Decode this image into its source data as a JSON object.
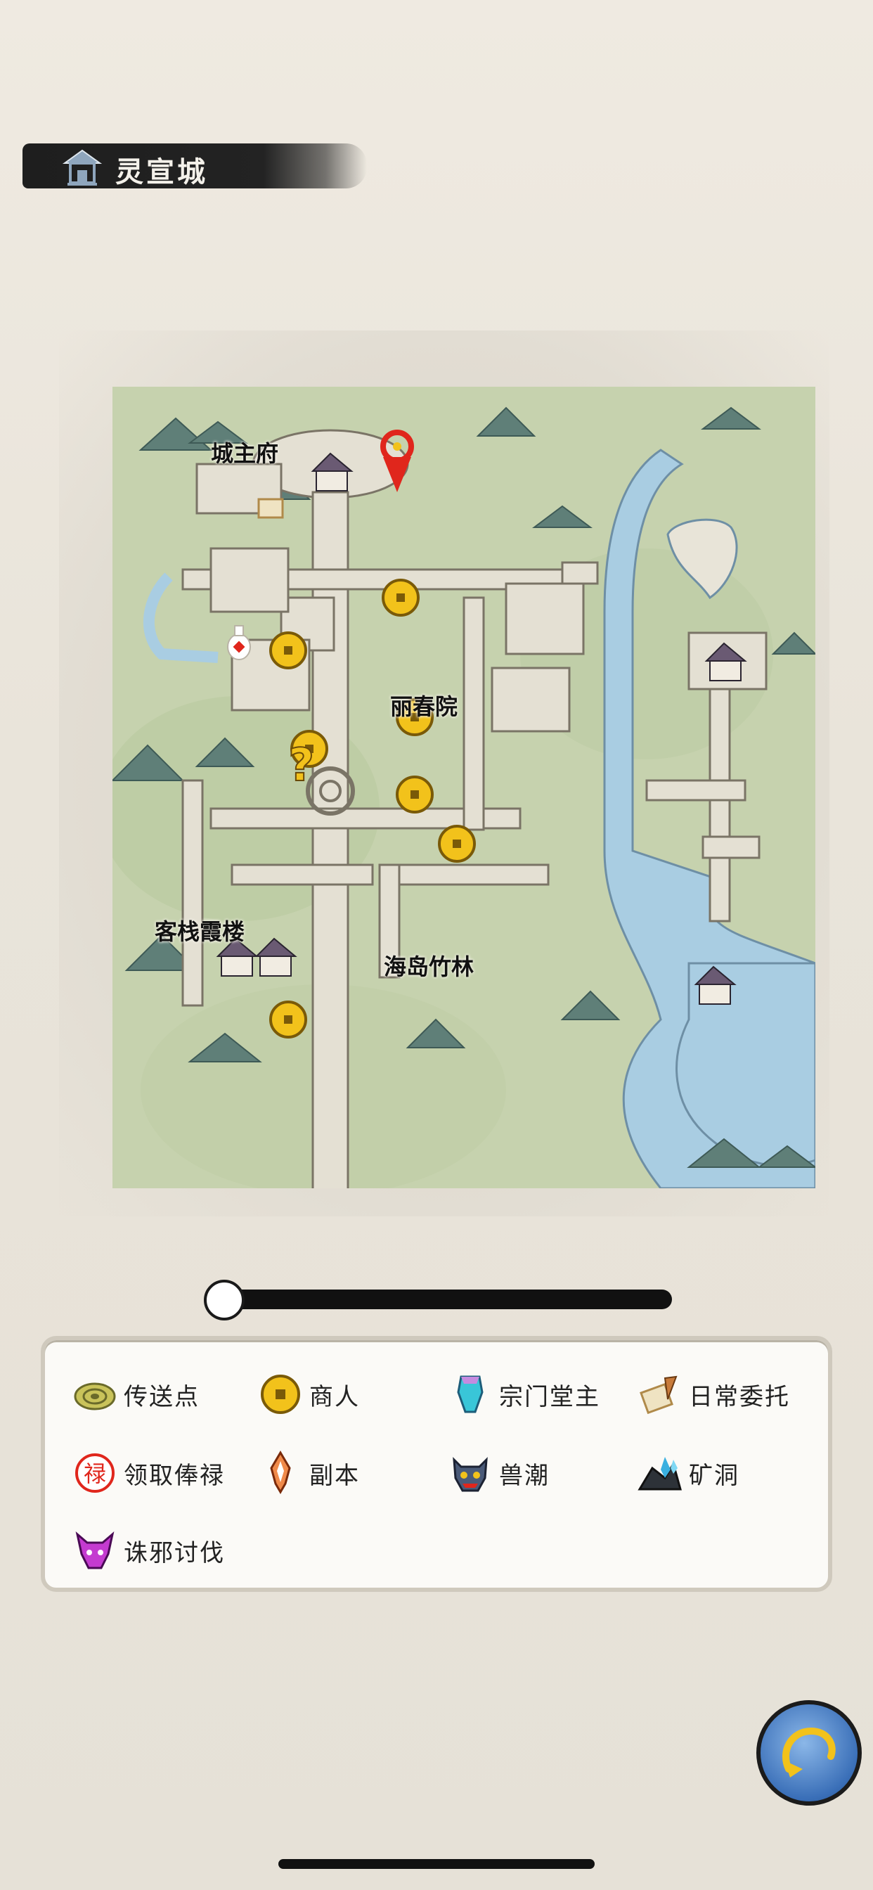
{
  "location": {
    "title": "灵宣城",
    "icon": "pavilion-icon"
  },
  "map": {
    "pois": [
      {
        "name": "城主府",
        "icon": "house-icon"
      },
      {
        "name": "丽春院",
        "icon": "house-icon"
      },
      {
        "name": "客栈",
        "icon": "house-icon"
      },
      {
        "name": "霞楼",
        "icon": "house-icon"
      },
      {
        "name": "海岛竹林",
        "icon": "house-icon"
      }
    ],
    "player_marker": "location-pin-icon",
    "quest_marker": "question-mark-icon"
  },
  "zoom_slider": {
    "value": 0.0
  },
  "legend": {
    "items": [
      {
        "label": "传送点",
        "icon": "teleport-swirl-icon"
      },
      {
        "label": "商人",
        "icon": "coin-icon"
      },
      {
        "label": "宗门堂主",
        "icon": "sect-crystal-icon"
      },
      {
        "label": "日常委托",
        "icon": "scroll-quill-icon"
      },
      {
        "label": "领取俸禄",
        "icon": "salary-seal-icon"
      },
      {
        "label": "副本",
        "icon": "dungeon-blade-icon"
      },
      {
        "label": "兽潮",
        "icon": "beast-head-icon"
      },
      {
        "label": "矿洞",
        "icon": "mine-crystal-icon"
      },
      {
        "label": "诛邪讨伐",
        "icon": "demon-head-icon"
      }
    ]
  },
  "back_button": {
    "icon": "return-swirl-icon"
  },
  "colors": {
    "accent_red": "#e0261c",
    "coin_gold": "#f2c21b",
    "water": "#a9cde2",
    "grass": "#c9d4b2"
  }
}
